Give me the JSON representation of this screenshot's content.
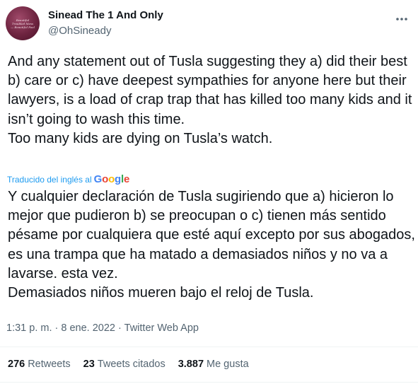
{
  "author": {
    "name": "Sinead The 1 And Only",
    "handle": "@OhSineady",
    "avatar_text": "Beautiful Troubled Mess — Beautiful Fool"
  },
  "tweet": {
    "text": "And any statement out of Tusla suggesting they a) did their best b) care or c) have deepest sympathies for anyone here but their lawyers, is a load of crap trap that has killed too many kids and it isn’t going to wash this time.\nToo many kids are dying on Tusla’s watch.",
    "translated_label": "Traducido del inglés al",
    "translator": "Google",
    "translation": "Y cualquier declaración de Tusla sugiriendo que a) hicieron lo mejor que pudieron b) se preocupan o c) tienen más sentido pésame por cualquiera que esté aquí excepto por sus abogados, es una trampa que ha matado a demasiados niños y no va a lavarse. esta vez.\n Demasiados niños mueren bajo el reloj de Tusla."
  },
  "meta": {
    "time": "1:31 p. m.",
    "separator": "·",
    "date": "8 ene. 2022",
    "source": "Twitter Web App"
  },
  "stats": {
    "retweets_count": "276",
    "retweets_label": "Retweets",
    "quotes_count": "23",
    "quotes_label": "Tweets citados",
    "likes_count": "3.887",
    "likes_label": "Me gusta"
  },
  "icons": {
    "more": "more-options-icon",
    "google_colors": [
      "#4285F4",
      "#EA4335",
      "#FBBC05",
      "#4285F4",
      "#34A853",
      "#EA4335"
    ]
  }
}
